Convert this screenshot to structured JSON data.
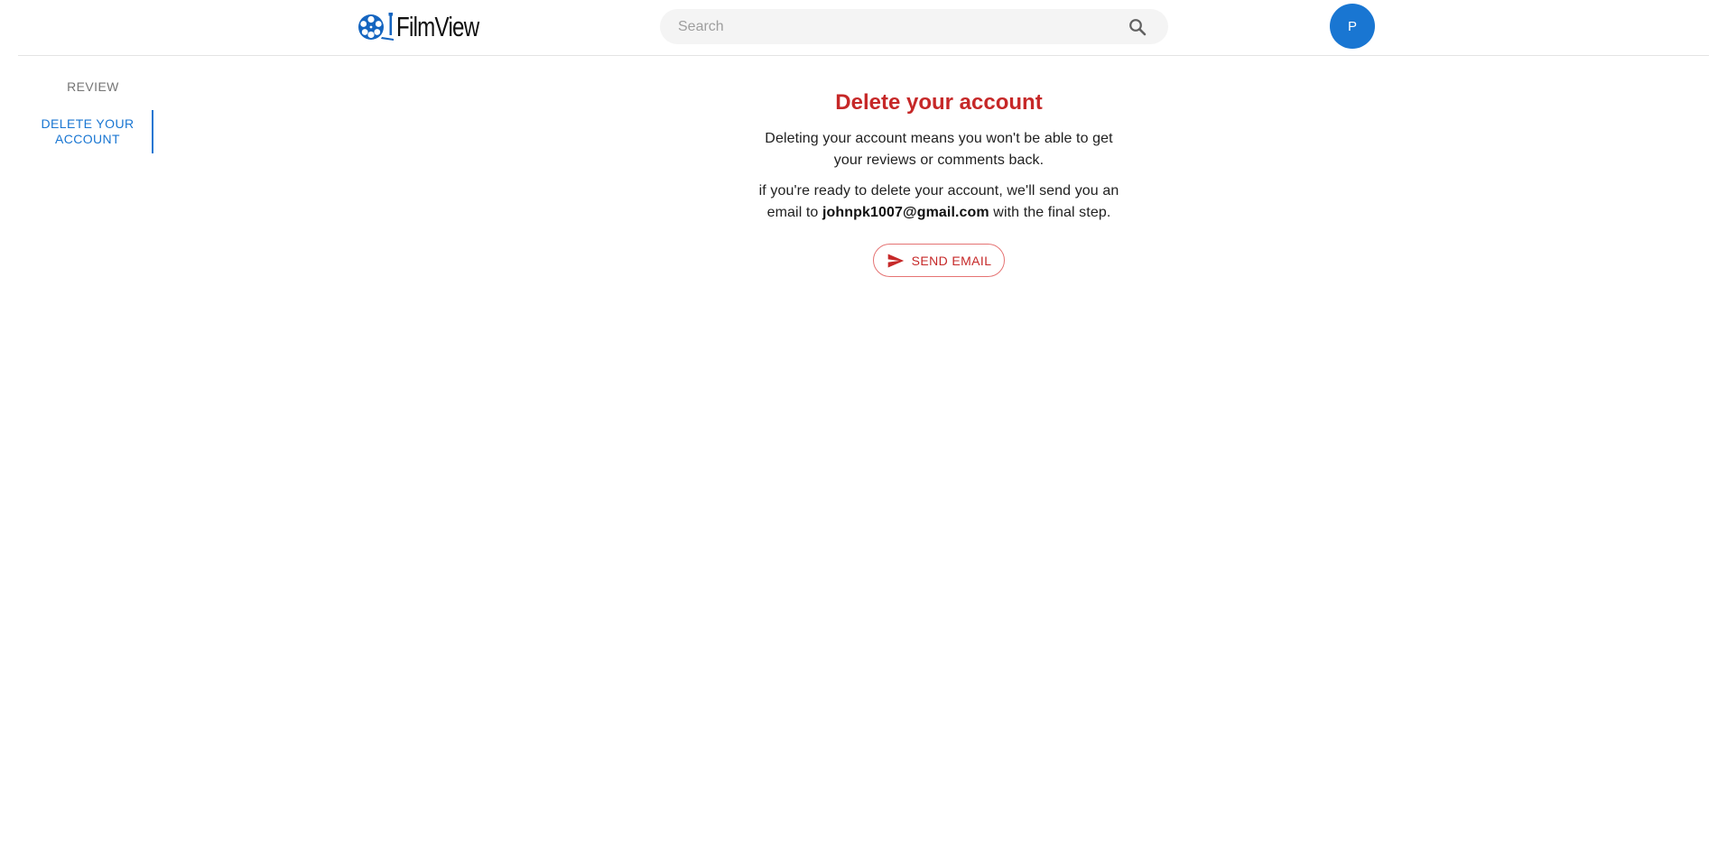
{
  "header": {
    "logo_text": "FilmView",
    "logo_icon": "film-reel-icon",
    "search": {
      "placeholder": "Search",
      "value": "",
      "icon": "search-icon"
    },
    "avatar_initial": "P",
    "accent_color": "#1976d2"
  },
  "sidebar": {
    "items": [
      {
        "label": "REVIEW",
        "active": false
      },
      {
        "label": "DELETE YOUR ACCOUNT",
        "active": true
      }
    ]
  },
  "main": {
    "title": "Delete your account",
    "paragraph1": "Deleting your account means you won't be able to get your reviews or comments back.",
    "paragraph2_prefix": "if you're ready to delete your account, we'll send you an email to ",
    "email": "johnpk1007@gmail.com",
    "paragraph2_suffix": " with the final step.",
    "send_button_label": "SEND EMAIL",
    "send_button_icon": "send-icon",
    "danger_color": "#c62828"
  }
}
